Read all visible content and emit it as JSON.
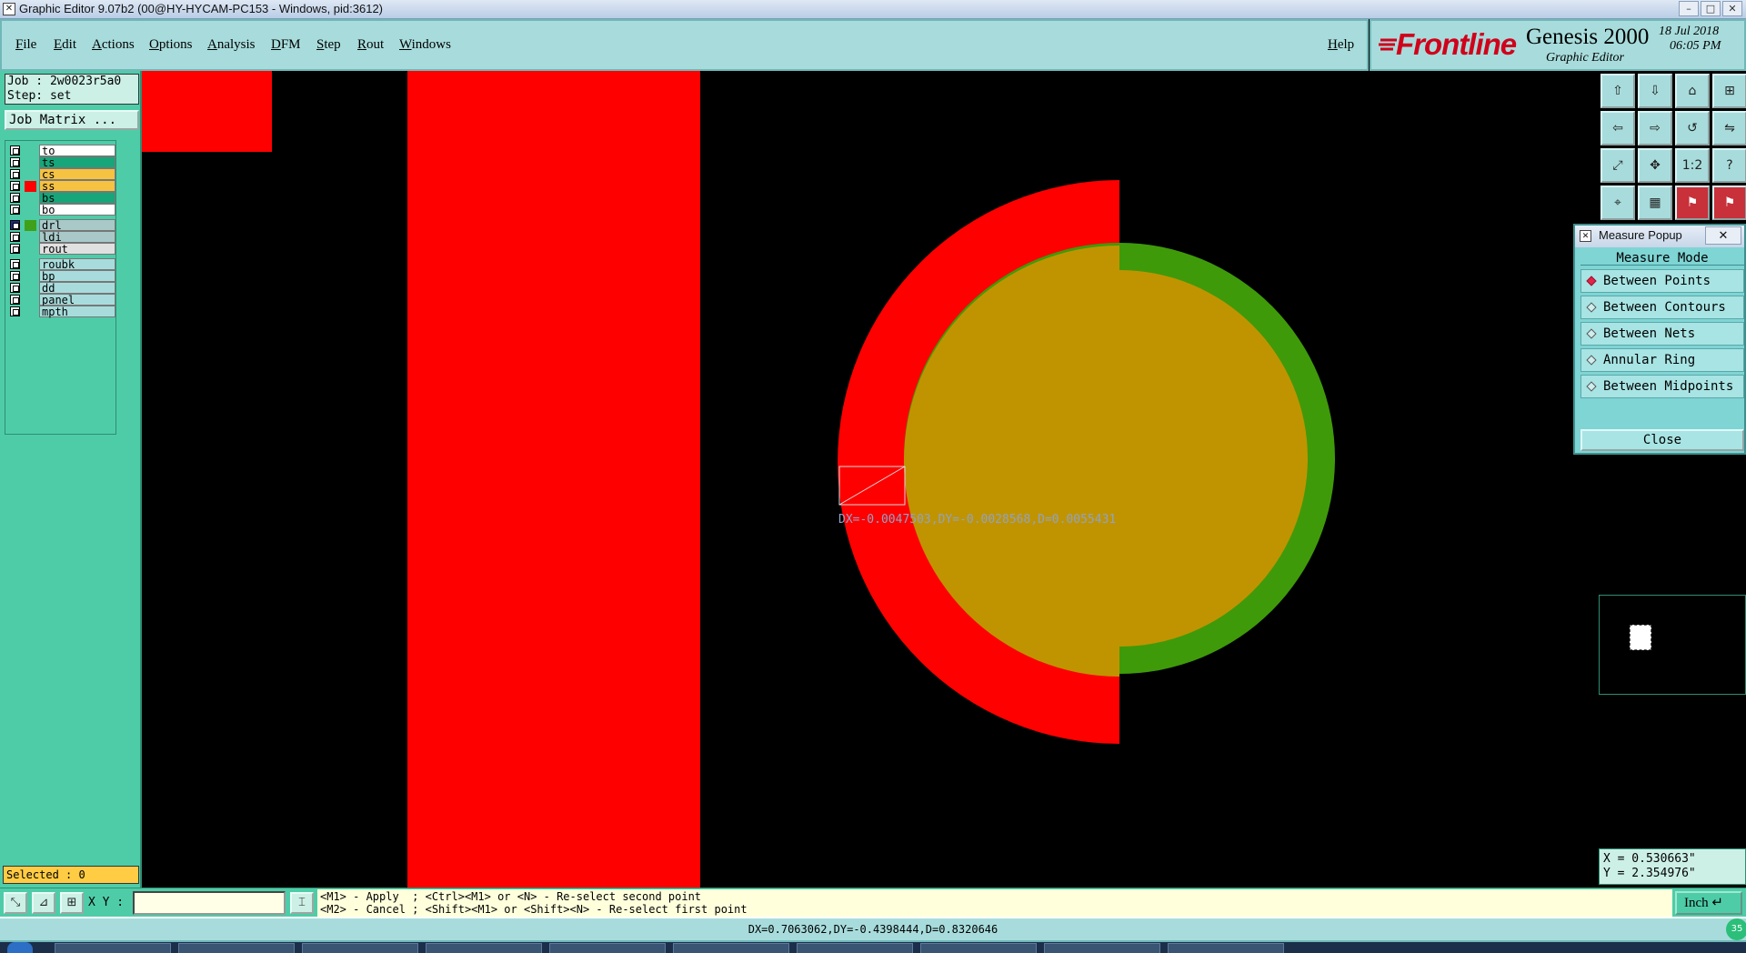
{
  "window": {
    "title": "Graphic Editor 9.07b2 (00@HY-HYCAM-PC153 - Windows, pid:3612)",
    "app_icon": "x-window-icon",
    "controls": [
      "minimize",
      "maximize",
      "close"
    ],
    "control_glyphs": {
      "minimize": "–",
      "maximize": "□",
      "close": "✕"
    }
  },
  "menubar": {
    "items": [
      "File",
      "Edit",
      "Actions",
      "Options",
      "Analysis",
      "DFM",
      "Step",
      "Rout",
      "Windows"
    ],
    "help": "Help"
  },
  "brand": {
    "logo": "Frontline",
    "product": "Genesis 2000",
    "subtitle": "Graphic Editor",
    "date": "18 Jul 2018",
    "time": "06:05 PM"
  },
  "left_panel": {
    "job": "Job : 2w0023r5a0",
    "step": "Step: set",
    "job_matrix_button": "Job Matrix ...",
    "layers": [
      {
        "name": "to",
        "label_color": "#ffffff",
        "swatch": ""
      },
      {
        "name": "ts",
        "label_color": "#17a57a",
        "swatch": ""
      },
      {
        "name": "cs",
        "label_color": "#f5c242",
        "swatch": ""
      },
      {
        "name": "ss",
        "label_color": "#f5c242",
        "swatch": "#ff0000"
      },
      {
        "name": "bs",
        "label_color": "#17a57a",
        "swatch": ""
      },
      {
        "name": "bo",
        "label_color": "#ffffff",
        "swatch": ""
      },
      {
        "name": "drl",
        "label_color": "#a9c9c9",
        "swatch": "#3fa01a",
        "active": true
      },
      {
        "name": "ldi",
        "label_color": "#a9c9c9",
        "swatch": ""
      },
      {
        "name": "rout",
        "label_color": "#e0e0e0",
        "swatch": ""
      },
      {
        "name": "roubk",
        "label_color": "#a8dcdc",
        "swatch": ""
      },
      {
        "name": "bp",
        "label_color": "#a8dcdc",
        "swatch": ""
      },
      {
        "name": "dd",
        "label_color": "#a8dcdc",
        "swatch": ""
      },
      {
        "name": "panel",
        "label_color": "#a8dcdc",
        "swatch": ""
      },
      {
        "name": "mpth",
        "label_color": "#a8dcdc",
        "swatch": ""
      }
    ],
    "selected": "Selected : 0"
  },
  "canvas": {
    "measure_readout": "DX=-0.0047503,DY=-0.0028568,D=0.0055431",
    "colors": {
      "red_layer": "#ff0000",
      "drill_overlap": "#c09400",
      "drill_ring": "#3f9a0a"
    }
  },
  "toolbar_icons": [
    "move-up-icon",
    "move-down-icon",
    "home-icon",
    "split-window-icon",
    "move-left-icon",
    "move-right-icon",
    "rotate-icon",
    "flip-icon",
    "zoom-fit-icon",
    "zoom-center-icon",
    "scale-1-2-icon",
    "help-icon",
    "snap-icon",
    "grid-icon",
    "layers-red-icon",
    "layers-blue-icon"
  ],
  "toolbar_glyphs": [
    "⇧",
    "⇩",
    "⌂",
    "⊞",
    "⇦",
    "⇨",
    "↺",
    "⇋",
    "⤢",
    "✥",
    "1:2",
    "?",
    "⌖",
    "▦",
    "⚑",
    "⚑"
  ],
  "measure_popup": {
    "title": "Measure Popup",
    "close_x": "✕",
    "mode_label": "Measure Mode",
    "options": [
      {
        "label": "Between Points",
        "selected": true
      },
      {
        "label": "Between Contours",
        "selected": false
      },
      {
        "label": "Between Nets",
        "selected": false
      },
      {
        "label": "Annular Ring",
        "selected": false
      },
      {
        "label": "Between Midpoints",
        "selected": false
      }
    ],
    "close_button": "Close"
  },
  "coords": {
    "x": "X = 0.530663\"",
    "y": "Y = 2.354976\""
  },
  "bottombar": {
    "xy_label": "X Y :",
    "xy_value": "",
    "buttons": [
      "zoom-area-icon",
      "measure-icon",
      "grid-snap-icon",
      "cursor-mode-icon"
    ],
    "button_glyphs": [
      "⤡",
      "⊿",
      "⊞",
      "⌶"
    ],
    "message_line1": "<M1> - Apply  ; <Ctrl><M1> or <N> - Re-select second point",
    "message_line2": "<M2> - Cancel ; <Shift><M1> or <Shift><N> - Re-select first point",
    "unit": "Inch",
    "unit_glyph": "↵"
  },
  "statusbar": {
    "text": "DX=0.7063062,DY=-0.4398444,D=0.8320646",
    "badge": "35"
  }
}
